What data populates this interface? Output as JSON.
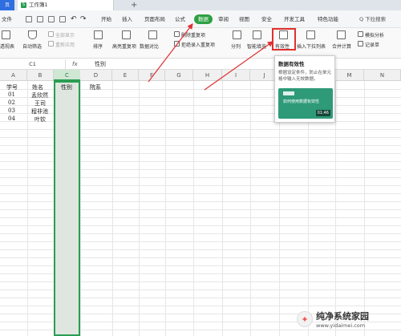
{
  "tabbar": {
    "home_label": "页",
    "doc_title": "工作簿1",
    "add_label": "+"
  },
  "menu": {
    "file": "文件",
    "items": [
      "开始",
      "插入",
      "页面布局",
      "公式",
      "数据",
      "审阅",
      "视图",
      "安全",
      "开发工具",
      "特色功能"
    ],
    "active": "数据",
    "search": "Q 下拉搜索"
  },
  "ribbon": {
    "items": [
      {
        "label": "透视表"
      },
      {
        "label": "自动筛选"
      },
      {
        "label": "全部显示"
      },
      {
        "label": "重新应用"
      },
      {
        "label": "排序"
      },
      {
        "label": "高亮重复项"
      },
      {
        "label": "数据对比"
      },
      {
        "label": "删除重复项"
      },
      {
        "label": "拒绝录入重复项"
      },
      {
        "label": "分列"
      },
      {
        "label": "智能填充"
      },
      {
        "label": "有效性"
      },
      {
        "label": "插入下拉列表"
      },
      {
        "label": "合并计算"
      },
      {
        "label": "模拟分析"
      },
      {
        "label": "记录单"
      }
    ]
  },
  "formula": {
    "cell": "C1",
    "fx": "fx",
    "value": "性别"
  },
  "columns": [
    "A",
    "B",
    "C",
    "D",
    "E",
    "F",
    "G",
    "H",
    "I",
    "J",
    "K",
    "L",
    "M",
    "N"
  ],
  "cells": {
    "A": [
      "学号",
      "01",
      "02",
      "03",
      "04"
    ],
    "B": [
      "姓名",
      "孟欣然",
      "王司",
      "程非池",
      "叶钦"
    ],
    "C1": "性别",
    "D1": "院系"
  },
  "tooltip": {
    "title": "数据有效性",
    "desc": "根据设定条件，防止在单元格中输入无效数据。",
    "video_text": "如何使用数据有效性",
    "time": "01:46"
  },
  "watermark": {
    "title": "纯净系统家园",
    "url": "www.yidaimei.com"
  },
  "colors": {
    "accent": "#2a9d52",
    "highlight": "#e03030",
    "tab_active": "#2f6ee0"
  }
}
